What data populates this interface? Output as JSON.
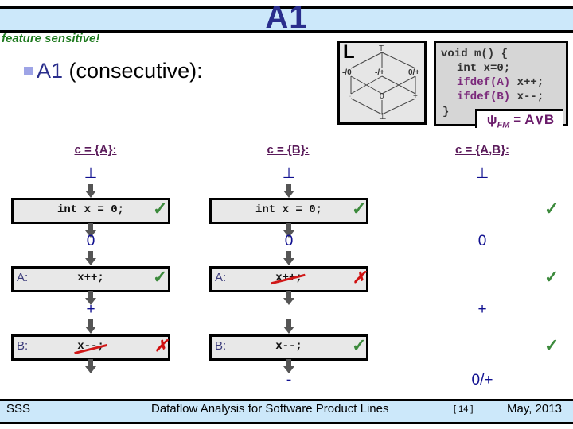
{
  "header": {
    "title": "A1",
    "subtitle": "feature sensitive!",
    "bullet_prefix": "A1",
    "bullet_suffix": " (consecutive):"
  },
  "lattice": {
    "label": "L",
    "nodes": {
      "top": "T",
      "left_mid": "-/0",
      "center_mid": "-/+",
      "right_mid": "0/+",
      "left_low": "-",
      "center_low": "0",
      "right_low": "+",
      "bottom": "⊥"
    }
  },
  "code": {
    "lines": [
      "void m() {",
      "  int x=0;",
      "  ifdef(A) x++;",
      "  ifdef(B) x--;",
      "}"
    ],
    "kw_a": "ifdef(A)",
    "stmt_a": " x++;",
    "kw_b": "ifdef(B)",
    "stmt_b": " x--;",
    "line0": "void m() {",
    "line1": "int x=0;",
    "line4": "}",
    "fm_psi": "ψ",
    "fm_sub": "FM",
    "fm_rest": " = A∨B"
  },
  "columns": [
    {
      "heading": "c = {A}:",
      "values": [
        "⊥",
        "0",
        "+",
        ""
      ],
      "stmts": [
        {
          "label": "",
          "code": "int x = 0;",
          "status": "✓"
        },
        {
          "label": "A:",
          "code": "x++;",
          "status": "✓"
        },
        {
          "label": "B:",
          "code": "x--;",
          "status": "✗",
          "struck": true
        }
      ]
    },
    {
      "heading": "c = {B}:",
      "values": [
        "⊥",
        "0",
        "",
        "-"
      ],
      "stmts": [
        {
          "label": "",
          "code": "int x = 0;",
          "status": "✓"
        },
        {
          "label": "A:",
          "code": "x++;",
          "status": "✗",
          "struck": true
        },
        {
          "label": "B:",
          "code": "x--;",
          "status": "✓"
        }
      ]
    },
    {
      "heading": "c = {A,B}:",
      "values": [
        "⊥",
        "0",
        "+",
        "0/+"
      ],
      "checks": [
        "✓",
        "✓",
        "✓"
      ]
    }
  ],
  "footer": {
    "left": "SSS",
    "center": "Dataflow Analysis for Software Product Lines",
    "page": "[ 14 ]",
    "date": "May, 2013"
  }
}
